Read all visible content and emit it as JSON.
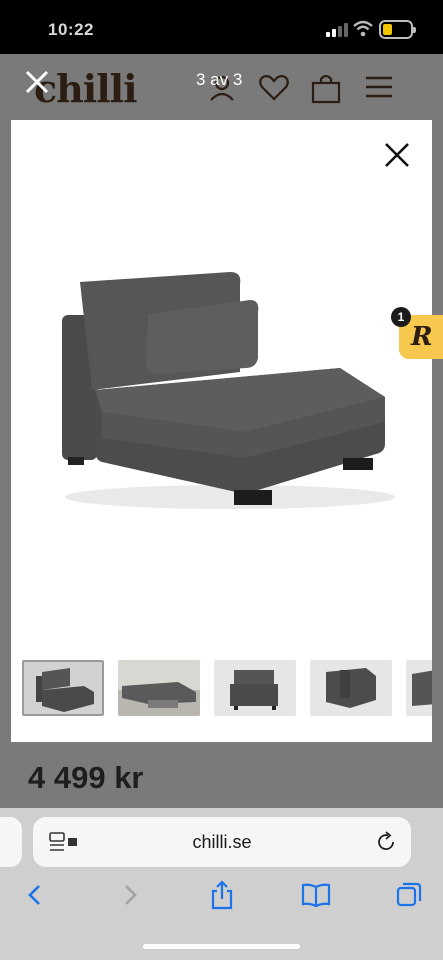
{
  "status_bar": {
    "time": "10:22"
  },
  "site": {
    "logo": "chilli"
  },
  "lightbox": {
    "counter": "3 av 3",
    "thumbnail_count": 5,
    "selected_thumbnail": 1
  },
  "reviews_badge": {
    "letter": "R",
    "count": "1"
  },
  "product": {
    "price": "4 499 kr"
  },
  "browser": {
    "url": "chilli.se"
  },
  "colors": {
    "badge": "#f7c84e",
    "accent": "#1a73e8",
    "logo": "#2b1d12"
  },
  "icons": [
    "close-icon",
    "user-icon",
    "heart-icon",
    "bag-icon",
    "menu-icon",
    "reader-icon",
    "reload-icon",
    "back-icon",
    "forward-icon",
    "share-icon",
    "bookmarks-icon",
    "tabs-icon"
  ]
}
